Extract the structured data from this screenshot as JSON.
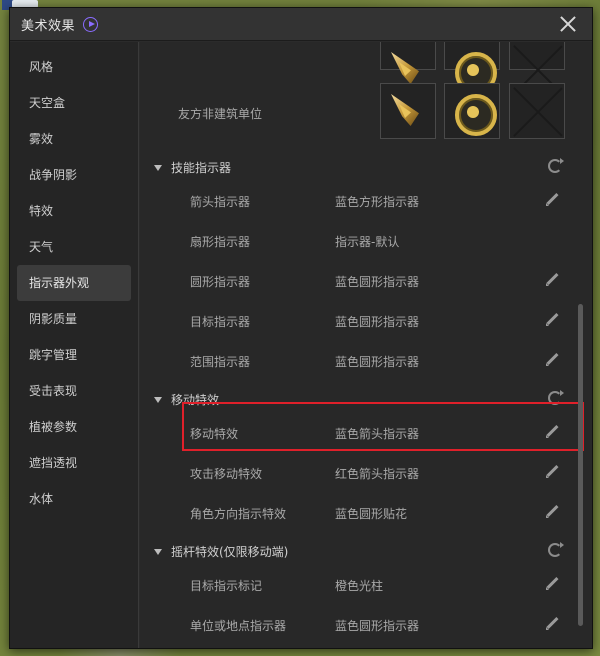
{
  "window": {
    "title": "美术效果"
  },
  "sidebar": {
    "items": [
      {
        "label": "风格"
      },
      {
        "label": "天空盒"
      },
      {
        "label": "雾效"
      },
      {
        "label": "战争阴影"
      },
      {
        "label": "特效"
      },
      {
        "label": "天气"
      },
      {
        "label": "指示器外观",
        "active": true
      },
      {
        "label": "阴影质量"
      },
      {
        "label": "跳字管理"
      },
      {
        "label": "受击表现"
      },
      {
        "label": "植被参数"
      },
      {
        "label": "遮挡透视"
      },
      {
        "label": "水体"
      }
    ]
  },
  "content": {
    "unit_row_label": "友方非建筑单位",
    "icons": [
      "arrow-marker-icon",
      "target-marker-icon",
      "none-icon"
    ],
    "sections": [
      {
        "title": "技能指示器",
        "items": [
          {
            "name": "箭头指示器",
            "value": "蓝色方形指示器",
            "editable": true
          },
          {
            "name": "扇形指示器",
            "value": "指示器-默认",
            "editable": false
          },
          {
            "name": "圆形指示器",
            "value": "蓝色圆形指示器",
            "editable": true
          },
          {
            "name": "目标指示器",
            "value": "蓝色圆形指示器",
            "editable": true
          },
          {
            "name": "范围指示器",
            "value": "蓝色圆形指示器",
            "editable": true
          }
        ]
      },
      {
        "title": "移动特效",
        "items": [
          {
            "name": "移动特效",
            "value": "蓝色箭头指示器",
            "editable": true
          },
          {
            "name": "攻击移动特效",
            "value": "红色箭头指示器",
            "editable": true
          },
          {
            "name": "角色方向指示特效",
            "value": "蓝色圆形贴花",
            "editable": true
          }
        ]
      },
      {
        "title": "摇杆特效(仅限移动端)",
        "items": [
          {
            "name": "目标指示标记",
            "value": "橙色光柱",
            "editable": true
          },
          {
            "name": "单位或地点指示器",
            "value": "蓝色圆形指示器",
            "editable": true
          }
        ]
      }
    ]
  },
  "colors": {
    "highlight": "#e0202a",
    "accent": "#8a6cff"
  }
}
